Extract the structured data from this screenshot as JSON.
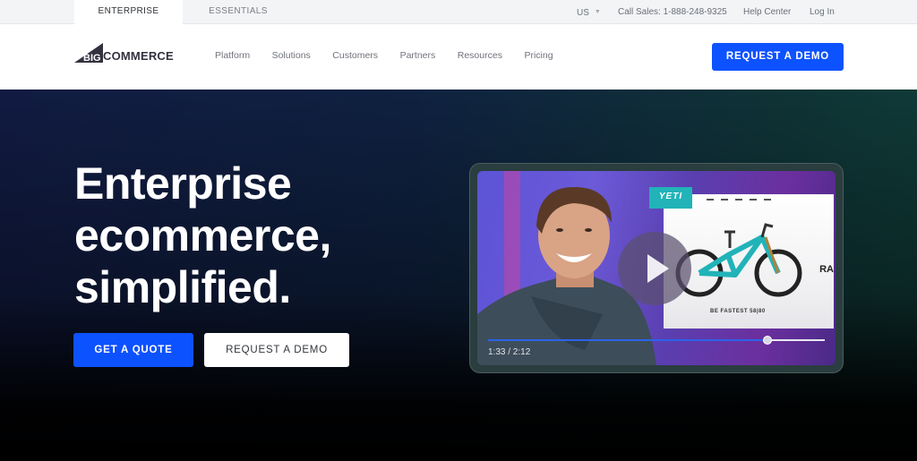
{
  "topbar": {
    "tabs": [
      {
        "label": "ENTERPRISE",
        "active": true
      },
      {
        "label": "ESSENTIALS",
        "active": false
      }
    ],
    "region": "US",
    "call_sales": "Call Sales: 1-888-248-9325",
    "help_center": "Help Center",
    "log_in": "Log In"
  },
  "navbar": {
    "logo_prefix": "BIG",
    "logo_text": "COMMERCE",
    "links": [
      "Platform",
      "Solutions",
      "Customers",
      "Partners",
      "Resources",
      "Pricing"
    ],
    "cta": "REQUEST A DEMO"
  },
  "hero": {
    "title_lines": [
      "Enterprise",
      "ecommerce,",
      "simplified."
    ],
    "primary_button": "GET A QUOTE",
    "secondary_button": "REQUEST A DEMO"
  },
  "video": {
    "time_display": "1:33 / 2:12",
    "progress_fraction": 0.83,
    "brand_badge": "YETI",
    "screen_tagline": "BE FASTEST 58|80",
    "screen_side_text": "RA"
  },
  "colors": {
    "accent": "#0d52ff",
    "yeti_teal": "#21b3b8"
  }
}
